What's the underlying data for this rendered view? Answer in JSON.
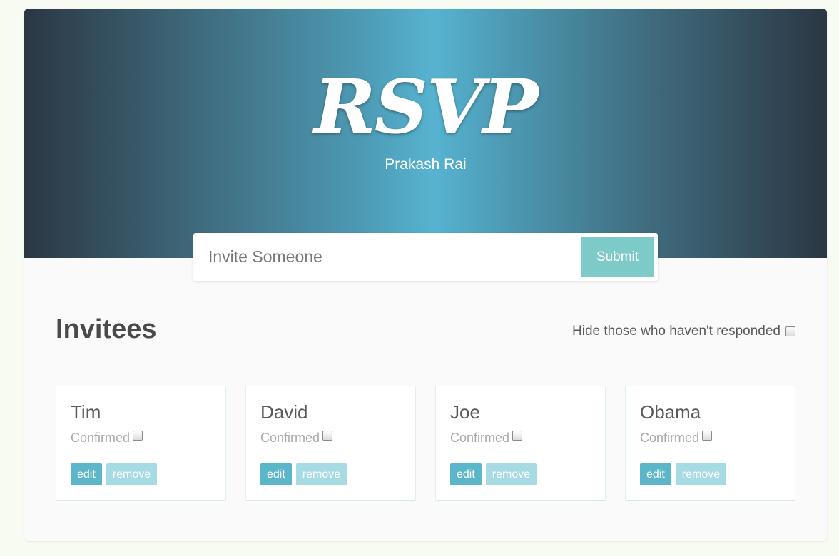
{
  "header": {
    "logo_text": "RSVP",
    "subtitle": "Prakash Rai"
  },
  "invite_form": {
    "input_placeholder": "Invite Someone",
    "input_value": "",
    "submit_label": "Submit"
  },
  "invitees": {
    "title": "Invitees",
    "filter_label": "Hide those who haven't responded",
    "filter_checked": false,
    "cards": [
      {
        "name": "Tim",
        "confirmed_label": "Confirmed",
        "confirmed": false,
        "edit_label": "edit",
        "remove_label": "remove"
      },
      {
        "name": "David",
        "confirmed_label": "Confirmed",
        "confirmed": false,
        "edit_label": "edit",
        "remove_label": "remove"
      },
      {
        "name": "Joe",
        "confirmed_label": "Confirmed",
        "confirmed": false,
        "edit_label": "edit",
        "remove_label": "remove"
      },
      {
        "name": "Obama",
        "confirmed_label": "Confirmed",
        "confirmed": false,
        "edit_label": "edit",
        "remove_label": "remove"
      }
    ]
  },
  "colors": {
    "header_center": "#56b3d0",
    "header_edge": "#2b3743",
    "submit_bg": "#7ecac9",
    "edit_bg": "#5bb6c9",
    "remove_bg": "#a6dbe3"
  }
}
